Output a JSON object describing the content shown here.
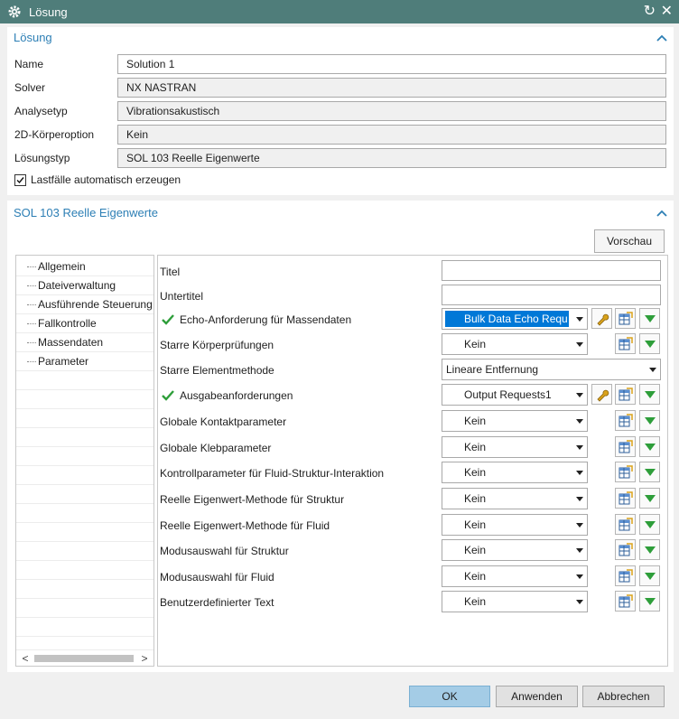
{
  "window": {
    "title": "Lösung",
    "refresh_glyph": "↻",
    "close_glyph": "✕"
  },
  "section1": {
    "title": "Lösung",
    "fields": [
      {
        "label": "Name",
        "value": "Solution 1",
        "editable": true
      },
      {
        "label": "Solver",
        "value": "NX NASTRAN",
        "editable": false
      },
      {
        "label": "Analysetyp",
        "value": "Vibrationsakustisch",
        "editable": false
      },
      {
        "label": "2D-Körperoption",
        "value": "Kein",
        "editable": false
      },
      {
        "label": "Lösungstyp",
        "value": "SOL 103 Reelle Eigenwerte",
        "editable": false
      }
    ],
    "checkbox": {
      "label": "Lastfälle automatisch erzeugen",
      "checked": true
    }
  },
  "section2": {
    "title": "SOL 103 Reelle Eigenwerte",
    "preview_button": "Vorschau",
    "tree": [
      "Allgemein",
      "Dateiverwaltung",
      "Ausführende Steuerung",
      "Fallkontrolle",
      "Massendaten",
      "Parameter"
    ],
    "scroll_left": "<",
    "scroll_right": ">",
    "params": [
      {
        "label": "Titel",
        "kind": "text",
        "value": ""
      },
      {
        "label": "Untertitel",
        "kind": "text",
        "value": ""
      },
      {
        "label": "Echo-Anforderung für Massendaten",
        "kind": "combo",
        "value": "Bulk Data Echo Requ",
        "check": true,
        "selected": true,
        "wrench": true,
        "tools": true
      },
      {
        "label": "Starre Körperprüfungen",
        "kind": "combo",
        "value": "Kein",
        "tools": true
      },
      {
        "label": "Starre Elementmethode",
        "kind": "wide",
        "value": "Lineare Entfernung"
      },
      {
        "label": "Ausgabeanforderungen",
        "kind": "combo",
        "value": "Output Requests1",
        "check": true,
        "wrench": true,
        "tools": true
      },
      {
        "label": "Globale Kontaktparameter",
        "kind": "combo",
        "value": "Kein",
        "tools": true
      },
      {
        "label": "Globale Klebparameter",
        "kind": "combo",
        "value": "Kein",
        "tools": true
      },
      {
        "label": "Kontrollparameter für Fluid-Struktur-Interaktion",
        "kind": "combo",
        "value": "Kein",
        "tools": true
      },
      {
        "label": "Reelle Eigenwert-Methode für Struktur",
        "kind": "combo",
        "value": "Kein",
        "tools": true
      },
      {
        "label": "Reelle Eigenwert-Methode für Fluid",
        "kind": "combo",
        "value": "Kein",
        "tools": true
      },
      {
        "label": "Modusauswahl für Struktur",
        "kind": "combo",
        "value": "Kein",
        "tools": true
      },
      {
        "label": "Modusauswahl für Fluid",
        "kind": "combo",
        "value": "Kein",
        "tools": true
      },
      {
        "label": "Benutzerdefinierter Text",
        "kind": "combo",
        "value": "Kein",
        "tools": true
      }
    ]
  },
  "footer": {
    "ok": "OK",
    "apply": "Anwenden",
    "cancel": "Abbrechen"
  },
  "colors": {
    "titlebar": "#4f7d7a",
    "section_title": "#2d7fb5",
    "green": "#2e9e3a",
    "selection": "#0078d7"
  },
  "icons": [
    "gear-icon",
    "refresh-icon",
    "close-icon",
    "collapse-caret-icon",
    "check-icon",
    "wrench-icon",
    "table-edit-icon",
    "green-dropdown-icon"
  ]
}
